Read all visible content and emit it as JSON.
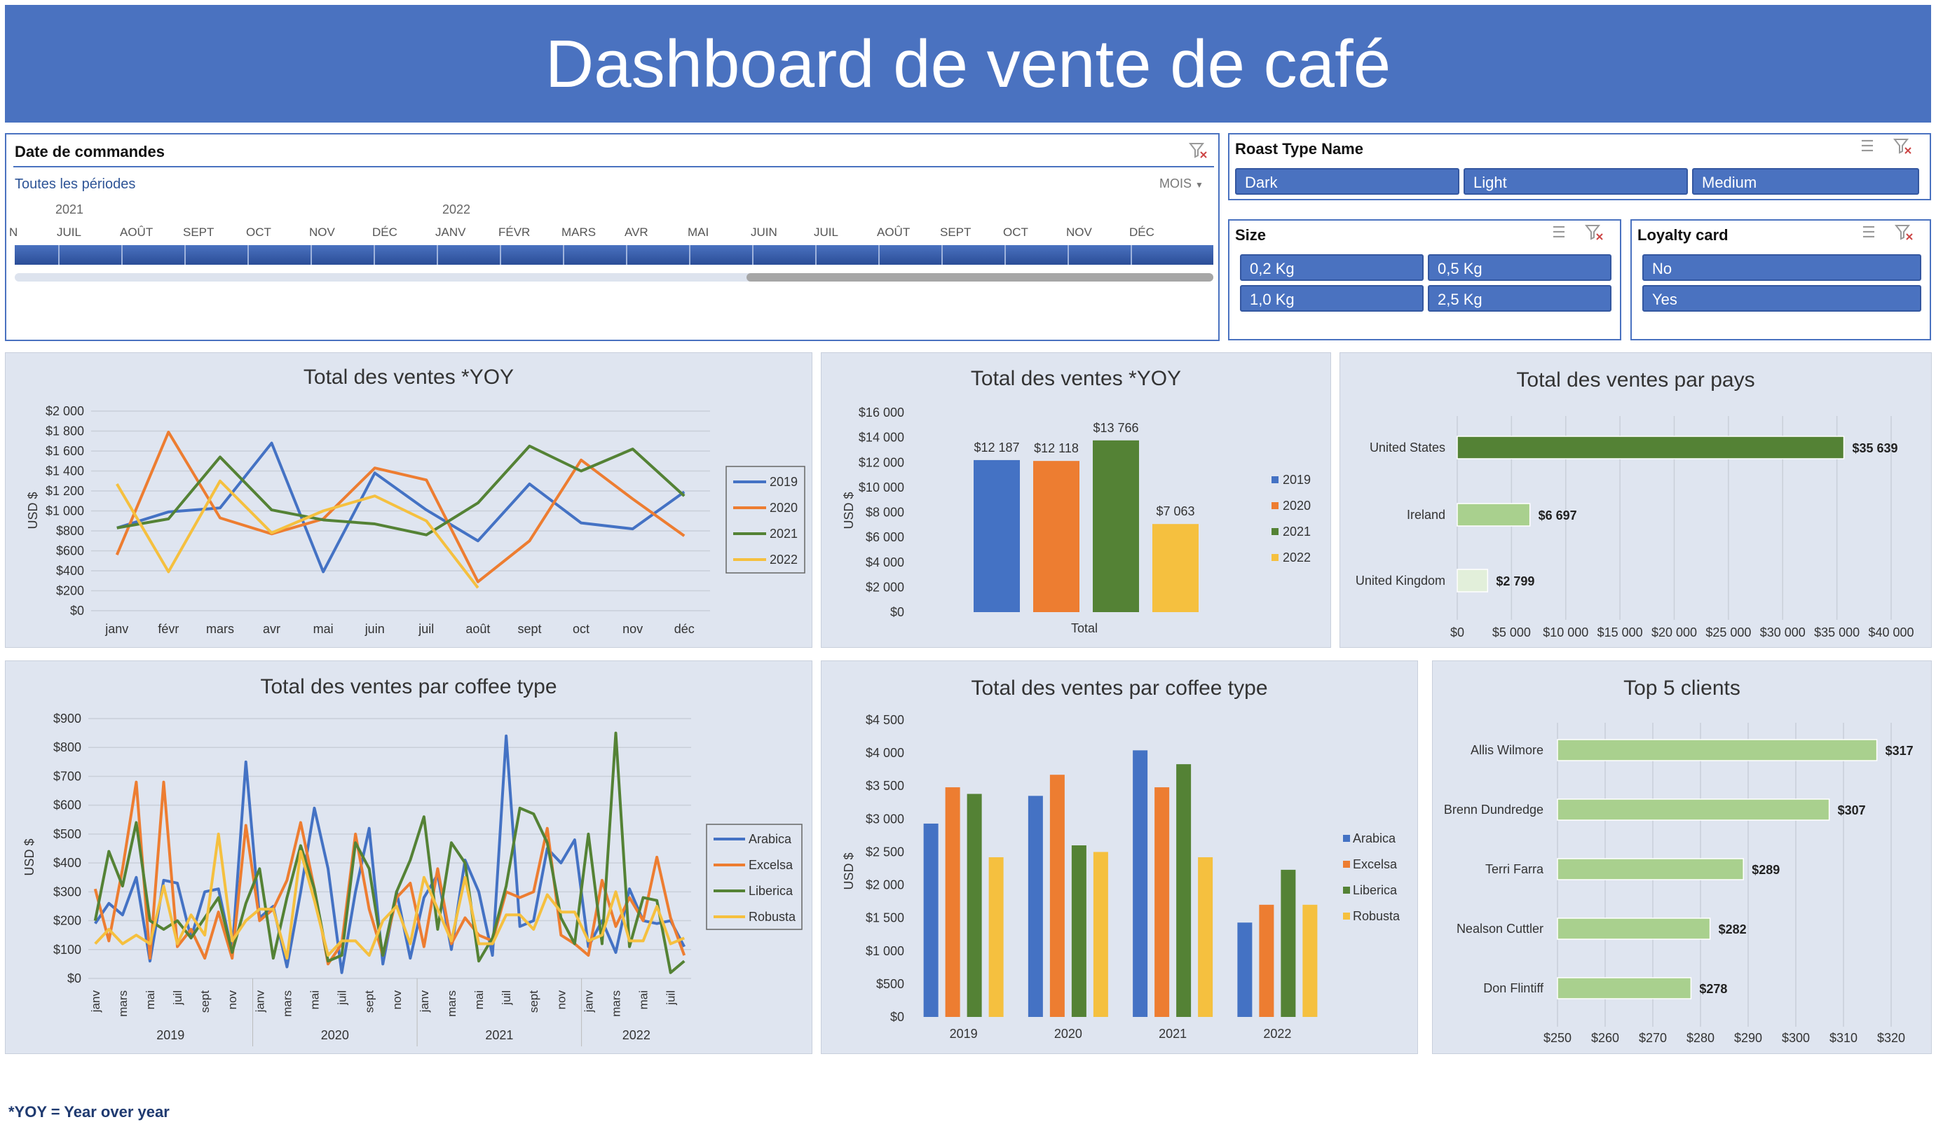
{
  "title": "Dashboard de vente de café",
  "footnote": "*YOY = Year over year",
  "colors": {
    "header": "#4a72c0",
    "y2019": "#4472c4",
    "y2020": "#ed7d31",
    "y2021": "#548235",
    "y2022": "#f5c03f",
    "arabica": "#4472c4",
    "excelsa": "#ed7d31",
    "liberica": "#548235",
    "robusta": "#f5c03f",
    "country_us": "#548235",
    "country_ie": "#a9d08e",
    "country_uk": "#e2efda",
    "clients": "#a9d08e"
  },
  "date_slicer": {
    "title": "Date de commandes",
    "period_label": "Toutes les périodes",
    "unit_label": "MOIS",
    "year_labels": [
      "2021",
      "2022"
    ],
    "months": [
      "N",
      "JUIL",
      "AOÛT",
      "SEPT",
      "OCT",
      "NOV",
      "DÉC",
      "JANV",
      "FÉVR",
      "MARS",
      "AVR",
      "MAI",
      "JUIN",
      "JUIL",
      "AOÛT",
      "SEPT",
      "OCT",
      "NOV",
      "DÉC"
    ],
    "icons": [
      "clear-filter-icon",
      "dropdown-icon"
    ]
  },
  "roast_slicer": {
    "title": "Roast Type Name",
    "items": [
      "Dark",
      "Light",
      "Medium"
    ],
    "icons": [
      "multiselect-icon",
      "clear-filter-icon"
    ]
  },
  "size_slicer": {
    "title": "Size",
    "items": [
      "0,2 Kg",
      "0,5 Kg",
      "1,0 Kg",
      "2,5 Kg"
    ],
    "icons": [
      "multiselect-icon",
      "clear-filter-icon"
    ]
  },
  "loyalty_slicer": {
    "title": "Loyalty card",
    "items": [
      "No",
      "Yes"
    ],
    "icons": [
      "multiselect-icon",
      "clear-filter-icon"
    ]
  },
  "chart_data": [
    {
      "type": "line",
      "title": "Total des ventes *YOY",
      "ylabel": "USD $",
      "categories": [
        "janv",
        "févr",
        "mars",
        "avr",
        "mai",
        "juin",
        "juil",
        "août",
        "sept",
        "oct",
        "nov",
        "déc"
      ],
      "yticks": [
        "$0",
        "$200",
        "$400",
        "$600",
        "$800",
        "$1 000",
        "$1 200",
        "$1 400",
        "$1 600",
        "$1 800",
        "$2 000"
      ],
      "ylim": [
        0,
        2000
      ],
      "grid": true,
      "legend": "right",
      "series": [
        {
          "name": "2019",
          "values": [
            830,
            990,
            1030,
            1680,
            390,
            1380,
            1010,
            700,
            1270,
            880,
            820,
            1190
          ]
        },
        {
          "name": "2020",
          "values": [
            560,
            1790,
            930,
            770,
            920,
            1430,
            1310,
            290,
            700,
            1510,
            1120,
            750
          ]
        },
        {
          "name": "2021",
          "values": [
            830,
            920,
            1540,
            1010,
            910,
            870,
            760,
            1080,
            1650,
            1400,
            1620,
            1150
          ]
        },
        {
          "name": "2022",
          "values": [
            1270,
            390,
            1300,
            780,
            1000,
            1150,
            900,
            230
          ]
        }
      ]
    },
    {
      "type": "bar",
      "title": "Total des ventes *YOY",
      "ylabel": "USD $",
      "categories": [
        "Total"
      ],
      "yticks": [
        "$0",
        "$2 000",
        "$4 000",
        "$6 000",
        "$8 000",
        "$10 000",
        "$12 000",
        "$14 000",
        "$16 000"
      ],
      "ylim": [
        0,
        16000
      ],
      "legend": "right",
      "series": [
        {
          "name": "2019",
          "values": [
            12187
          ],
          "label": "$12 187"
        },
        {
          "name": "2020",
          "values": [
            12118
          ],
          "label": "$12 118"
        },
        {
          "name": "2021",
          "values": [
            13766
          ],
          "label": "$13 766"
        },
        {
          "name": "2022",
          "values": [
            7063
          ],
          "label": "$7 063"
        }
      ]
    },
    {
      "type": "bar",
      "orientation": "horizontal",
      "title": "Total des ventes par pays",
      "categories": [
        "United States",
        "Ireland",
        "United Kingdom"
      ],
      "values": [
        35639,
        6697,
        2799
      ],
      "labels": [
        "$35 639",
        "$6 697",
        "$2 799"
      ],
      "xticks": [
        "$0",
        "$5 000",
        "$10 000",
        "$15 000",
        "$20 000",
        "$25 000",
        "$30 000",
        "$35 000",
        "$40 000"
      ],
      "xlim": [
        0,
        40000
      ]
    },
    {
      "type": "line",
      "title": "Total des ventes par coffee type",
      "ylabel": "USD $",
      "month_ticks": [
        "janv",
        "mars",
        "mai",
        "juil",
        "sept",
        "nov"
      ],
      "month_ticks_2022": [
        "janv",
        "mars",
        "mai",
        "juil"
      ],
      "years": [
        "2019",
        "2020",
        "2021",
        "2022"
      ],
      "yticks": [
        "$0",
        "$100",
        "$200",
        "$300",
        "$400",
        "$500",
        "$600",
        "$700",
        "$800",
        "$900"
      ],
      "ylim": [
        0,
        900
      ],
      "grid": true,
      "legend": "right",
      "series": [
        {
          "name": "Arabica",
          "values": [
            190,
            260,
            220,
            350,
            60,
            340,
            330,
            140,
            300,
            310,
            90,
            750,
            210,
            250,
            40,
            300,
            590,
            380,
            20,
            300,
            520,
            50,
            300,
            70,
            280,
            360,
            100,
            410,
            300,
            80,
            840,
            180,
            200,
            450,
            400,
            480,
            110,
            200,
            90,
            310,
            200,
            190,
            200,
            110
          ]
        },
        {
          "name": "Excelsa",
          "values": [
            310,
            130,
            380,
            680,
            70,
            680,
            110,
            170,
            70,
            230,
            70,
            530,
            200,
            240,
            340,
            540,
            310,
            50,
            120,
            500,
            240,
            80,
            280,
            330,
            110,
            380,
            120,
            210,
            150,
            130,
            300,
            280,
            300,
            520,
            150,
            120,
            80,
            340,
            180,
            280,
            200,
            420,
            210,
            80
          ]
        },
        {
          "name": "Liberica",
          "values": [
            200,
            440,
            320,
            540,
            200,
            170,
            200,
            140,
            210,
            280,
            90,
            260,
            380,
            70,
            280,
            460,
            310,
            60,
            80,
            470,
            380,
            80,
            300,
            410,
            560,
            170,
            470,
            400,
            60,
            140,
            320,
            590,
            570,
            470,
            210,
            120,
            500,
            120,
            850,
            110,
            280,
            270,
            20,
            60
          ]
        },
        {
          "name": "Robusta",
          "values": [
            120,
            170,
            120,
            150,
            120,
            320,
            120,
            220,
            150,
            500,
            130,
            200,
            240,
            240,
            70,
            440,
            270,
            80,
            130,
            130,
            80,
            200,
            250,
            120,
            350,
            240,
            130,
            350,
            120,
            120,
            220,
            220,
            170,
            290,
            230,
            230,
            130,
            150,
            300,
            130,
            130,
            250,
            120,
            140
          ]
        }
      ]
    },
    {
      "type": "bar",
      "title": "Total des ventes par coffee type",
      "ylabel": "USD $",
      "categories": [
        "2019",
        "2020",
        "2021",
        "2022"
      ],
      "yticks": [
        "$0",
        "$500",
        "$1 000",
        "$1 500",
        "$2 000",
        "$2 500",
        "$3 000",
        "$3 500",
        "$4 000",
        "$4 500"
      ],
      "ylim": [
        0,
        4500
      ],
      "legend": "right",
      "series": [
        {
          "name": "Arabica",
          "values": [
            2930,
            3350,
            4040,
            1430
          ]
        },
        {
          "name": "Excelsa",
          "values": [
            3480,
            3670,
            3480,
            1700
          ]
        },
        {
          "name": "Liberica",
          "values": [
            3380,
            2600,
            3830,
            2230
          ]
        },
        {
          "name": "Robusta",
          "values": [
            2420,
            2500,
            2420,
            1700
          ]
        }
      ]
    },
    {
      "type": "bar",
      "orientation": "horizontal",
      "title": "Top 5 clients",
      "categories": [
        "Allis Wilmore",
        "Brenn Dundredge",
        "Terri Farra",
        "Nealson Cuttler",
        "Don Flintiff"
      ],
      "values": [
        317,
        307,
        289,
        282,
        278
      ],
      "labels": [
        "$317",
        "$307",
        "$289",
        "$282",
        "$278"
      ],
      "xticks": [
        "$250",
        "$260",
        "$270",
        "$280",
        "$290",
        "$300",
        "$310",
        "$320"
      ],
      "xlim": [
        250,
        320
      ]
    }
  ]
}
